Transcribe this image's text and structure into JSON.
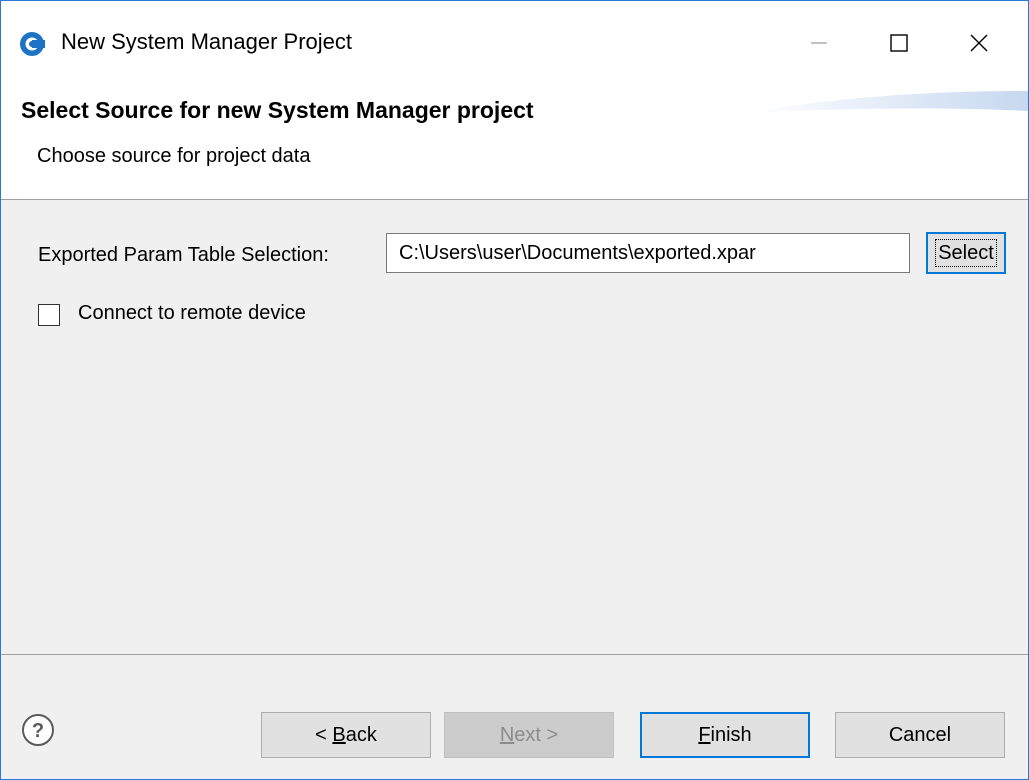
{
  "window": {
    "title": "New System Manager Project",
    "icon": "app-logo-icon"
  },
  "header": {
    "title": "Select Source for new System Manager project",
    "subtitle": "Choose source for project data"
  },
  "form": {
    "param_label": "Exported Param Table Selection:",
    "param_value": "C:\\Users\\user\\Documents\\exported.xpar",
    "select_label": "Select",
    "connect_label": "Connect to remote device",
    "connect_checked": false
  },
  "footer": {
    "back_prefix": "< ",
    "back_mnemonic": "B",
    "back_rest": "ack",
    "next_mnemonic": "N",
    "next_rest": "ext >",
    "finish_mnemonic": "F",
    "finish_rest": "inish",
    "cancel_label": "Cancel"
  },
  "colors": {
    "accent": "#0078d7",
    "window_border": "#2b79d6",
    "dialog_bg": "#f0f0f0"
  }
}
